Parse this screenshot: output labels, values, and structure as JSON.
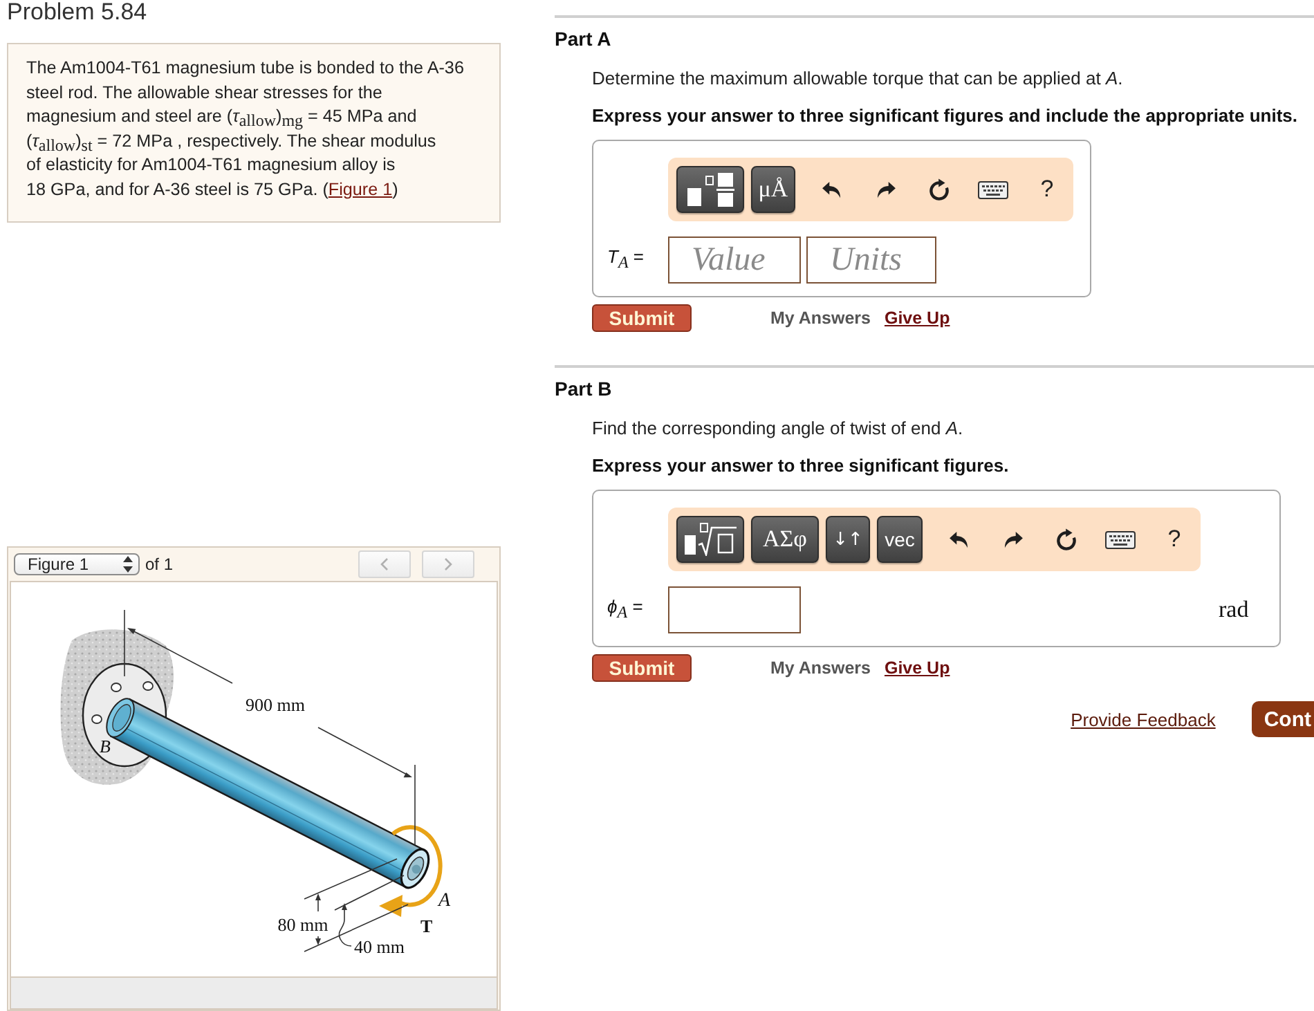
{
  "problem": {
    "title": "Problem 5.84",
    "statement": {
      "text": "The Am1004-T61 magnesium tube is bonded to the A-36\nsteel rod. The allowable shear stresses for the\nmagnesium and steel are (*τ*$_{allow}$)$_{mg}$ = 45 MPa and\n(*τ*$_{allow}$)$_{st}$ = 72 MPa , respectively. The shear modulus\nof elasticity for Am1004-T61 magnesium alloy is\n18 GPa, and for A-36 steel is 75 GPa. (",
      "link": "Figure 1",
      "after": ")"
    }
  },
  "figure_panel": {
    "select": "Figure 1",
    "count": "of 1",
    "nav": [
      {
        "kind": "previous",
        "disabled": true
      },
      {
        "kind": "next",
        "disabled": true
      }
    ],
    "labels": {
      "length": "900 mm",
      "outer_dimension": "80 mm",
      "inner_dimension": "40 mm",
      "end_a": "A",
      "end_b": "B",
      "torque": "T"
    }
  },
  "parts": [
    {
      "title": "Part A",
      "question": "Determine the maximum allowable torque that can be applied at *A*.",
      "instruction": "Express your answer to three significant figures and include the appropriate units.",
      "toolbar": [
        {
          "kind": "fraction_template"
        },
        {
          "kind": "units",
          "label": "μÅ"
        },
        {
          "kind": "undo"
        },
        {
          "kind": "redo"
        },
        {
          "kind": "reset"
        },
        {
          "kind": "keyboard"
        },
        {
          "kind": "help",
          "label": "?"
        }
      ],
      "variable": "*T*$_{A}$ =",
      "fields": [
        {
          "kind": "value",
          "placeholder": "Value"
        },
        {
          "kind": "units",
          "placeholder": "Units"
        }
      ],
      "submit": "Submit",
      "links": [
        {
          "kind": "my_answers",
          "label": "My Answers"
        },
        {
          "kind": "give_up",
          "label": "Give Up"
        }
      ]
    },
    {
      "title": "Part B",
      "question": "Find the corresponding angle of twist of end *A*.",
      "instruction": "Express your answer to three significant figures.",
      "toolbar": [
        {
          "kind": "root_template"
        },
        {
          "kind": "greek",
          "label": "ΑΣφ"
        },
        {
          "kind": "arrows",
          "label": "↓↑"
        },
        {
          "kind": "vector",
          "label": "vec"
        },
        {
          "kind": "undo"
        },
        {
          "kind": "redo"
        },
        {
          "kind": "reset"
        },
        {
          "kind": "keyboard"
        },
        {
          "kind": "help",
          "label": "?"
        }
      ],
      "variable": "*ϕ*$_{A}$ =",
      "fields": [
        {
          "kind": "value"
        }
      ],
      "unit": "rad",
      "submit": "Submit",
      "links": [
        {
          "kind": "my_answers",
          "label": "My Answers"
        },
        {
          "kind": "give_up",
          "label": "Give Up"
        }
      ]
    }
  ],
  "footer": {
    "feedback": "Provide Feedback",
    "continue": "Cont"
  }
}
